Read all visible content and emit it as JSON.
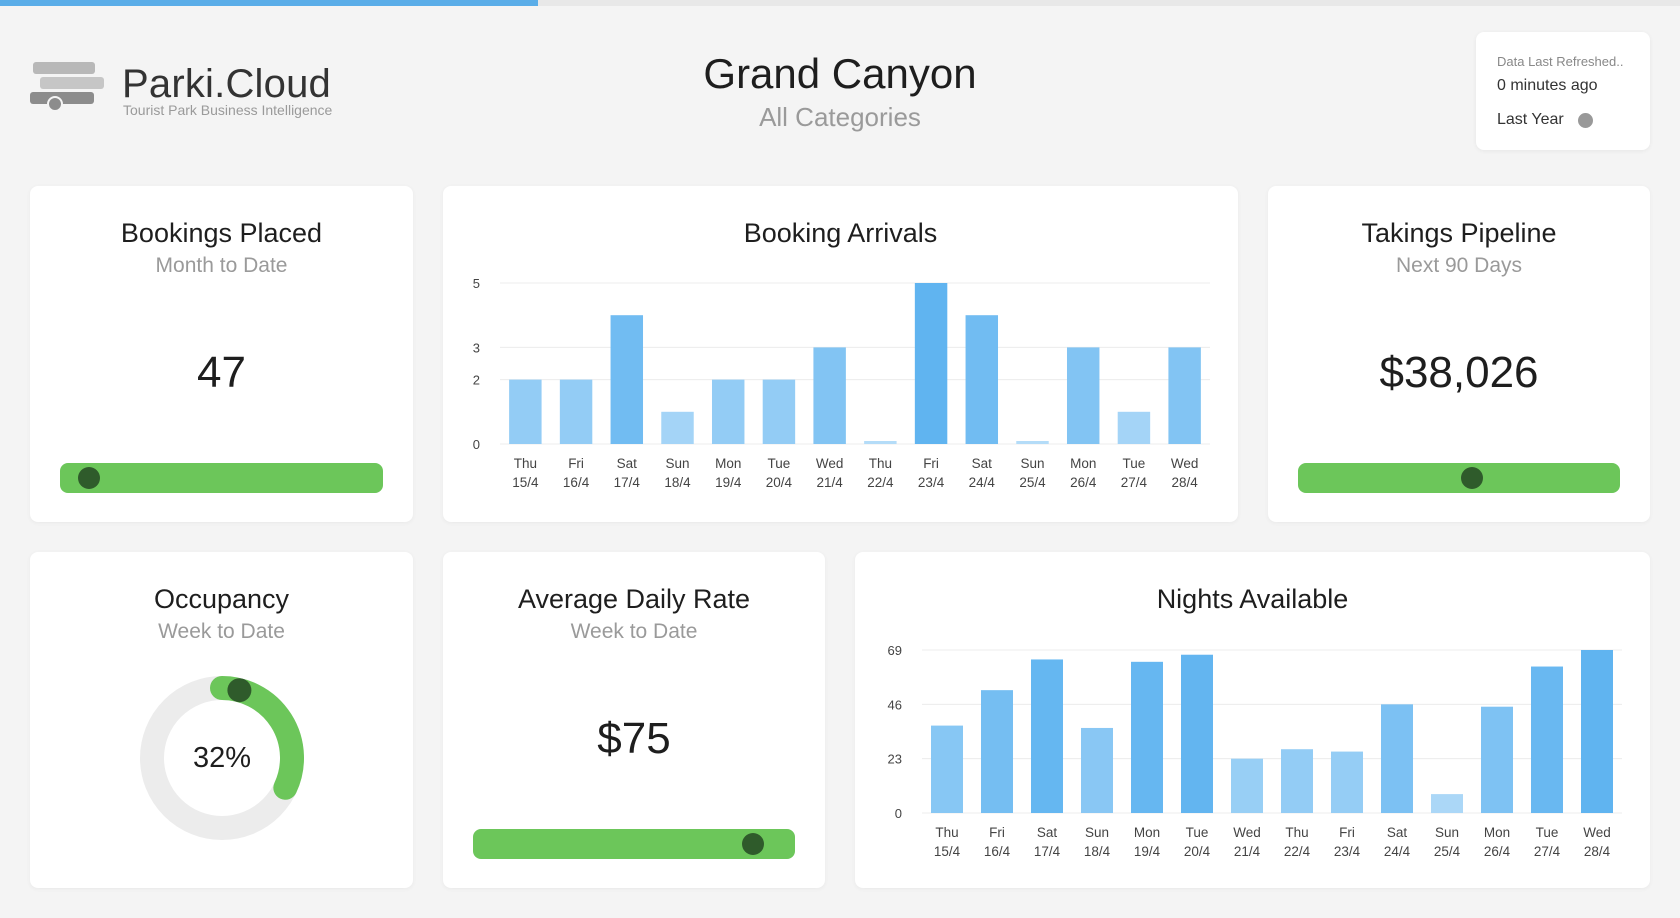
{
  "app": {
    "progress": 0.32,
    "brand": "Parki.Cloud",
    "tagline": "Tourist Park Business Intelligence"
  },
  "header": {
    "title": "Grand Canyon",
    "subtitle": "All Categories"
  },
  "refresh": {
    "label": "Data Last Refreshed..",
    "value": "0 minutes ago",
    "period": "Last Year"
  },
  "bookings_placed": {
    "title": "Bookings Placed",
    "subtitle": "Month to Date",
    "value": "47",
    "progress": 0.09
  },
  "takings_pipeline": {
    "title": "Takings Pipeline",
    "subtitle": "Next 90 Days",
    "value": "$38,026",
    "progress": 0.54
  },
  "occupancy": {
    "title": "Occupancy",
    "subtitle": "Week to Date",
    "value": "32%",
    "fraction": 0.32
  },
  "average_daily_rate": {
    "title": "Average Daily Rate",
    "subtitle": "Week to Date",
    "value": "$75",
    "progress": 0.87
  },
  "colors": {
    "accent": "#5aade8",
    "green": "#6cc65a",
    "knob": "#2f5b2b",
    "track": "#ececec"
  },
  "chart_data": [
    {
      "id": "booking-arrivals",
      "type": "bar",
      "title": "Booking Arrivals",
      "categories": [
        "Thu 15/4",
        "Fri 16/4",
        "Sat 17/4",
        "Sun 18/4",
        "Mon 19/4",
        "Tue 20/4",
        "Wed 21/4",
        "Thu 22/4",
        "Fri 23/4",
        "Sat 24/4",
        "Sun 25/4",
        "Mon 26/4",
        "Tue 27/4",
        "Wed 28/4"
      ],
      "values": [
        2,
        2,
        4,
        1,
        2,
        2,
        3,
        0,
        5,
        4,
        0,
        3,
        1,
        3
      ],
      "yticks": [
        0,
        2,
        3,
        5
      ],
      "ylim": [
        0,
        5
      ],
      "grid": true
    },
    {
      "id": "nights-available",
      "type": "bar",
      "title": "Nights Available",
      "categories": [
        "Thu 15/4",
        "Fri 16/4",
        "Sat 17/4",
        "Sun 18/4",
        "Mon 19/4",
        "Tue 20/4",
        "Wed 21/4",
        "Thu 22/4",
        "Fri 23/4",
        "Sat 24/4",
        "Sun 25/4",
        "Mon 26/4",
        "Tue 27/4",
        "Wed 28/4"
      ],
      "values": [
        37,
        52,
        65,
        36,
        64,
        67,
        23,
        27,
        26,
        46,
        8,
        45,
        62,
        69
      ],
      "yticks": [
        0,
        23,
        46,
        69
      ],
      "ylim": [
        0,
        69
      ],
      "grid": true
    }
  ]
}
